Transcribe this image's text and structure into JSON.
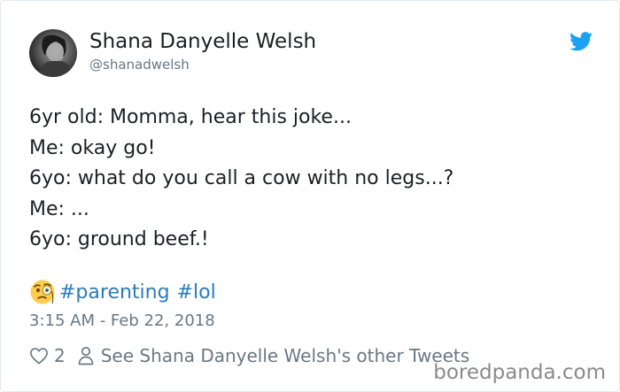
{
  "tweet": {
    "author_name": "Shana Danyelle Welsh",
    "author_handle": "@shanadwelsh",
    "lines": [
      "6yr old: Momma, hear this joke...",
      "Me: okay go!",
      "6yo: what do you call a cow with no legs...?",
      "Me: ...",
      "6yo: ground beef.!"
    ],
    "emoji": "face-with-monocle",
    "hashtags": [
      "#parenting",
      "#lol"
    ],
    "timestamp": "3:15 AM - Feb 22, 2018",
    "like_count": "2",
    "other_tweets_label": "See Shana Danyelle Welsh's other Tweets"
  },
  "watermark": "boredpanda.com",
  "colors": {
    "link": "#2b7bb9",
    "twitter_blue": "#1da1f2",
    "muted": "#697882",
    "text": "#1c2022"
  }
}
